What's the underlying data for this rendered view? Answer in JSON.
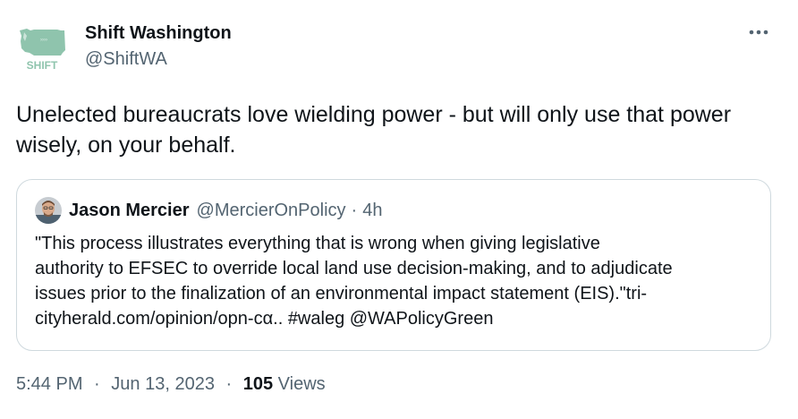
{
  "author": {
    "display_name": "Shift Washington",
    "handle": "@ShiftWA",
    "logo_text": "SHIFT"
  },
  "tweet": {
    "text": "Unelected bureaucrats love wielding power - but will only use that power wisely, on your behalf."
  },
  "quoted_tweet": {
    "display_name": "Jason Mercier",
    "handle": "@MercierOnPolicy",
    "separator": "·",
    "time": "4h",
    "lines": [
      "\"This process illustrates everything that is wrong when giving legislative",
      "authority to EFSEC to override local land use decision-making, and to adjudicate",
      "issues prior to the finalization of an environmental impact statement (EIS).\"tri-",
      "cityherald.com/opinion/opn-cα.. #waleg @WAPolicyGreen"
    ]
  },
  "meta": {
    "time": "5:44 PM",
    "date": "Jun 13, 2023",
    "separator": "·",
    "views_count": "105",
    "views_label": "Views"
  },
  "icons": {
    "more": "more-horizontal-icon",
    "author_avatar": "washington-state-map-logo",
    "quoted_avatar": "person-photo-avatar"
  },
  "colors": {
    "logo_green": "#8fc4ad",
    "secondary_text": "#536471",
    "primary_text": "#0f1419",
    "border": "#cfd9de"
  }
}
